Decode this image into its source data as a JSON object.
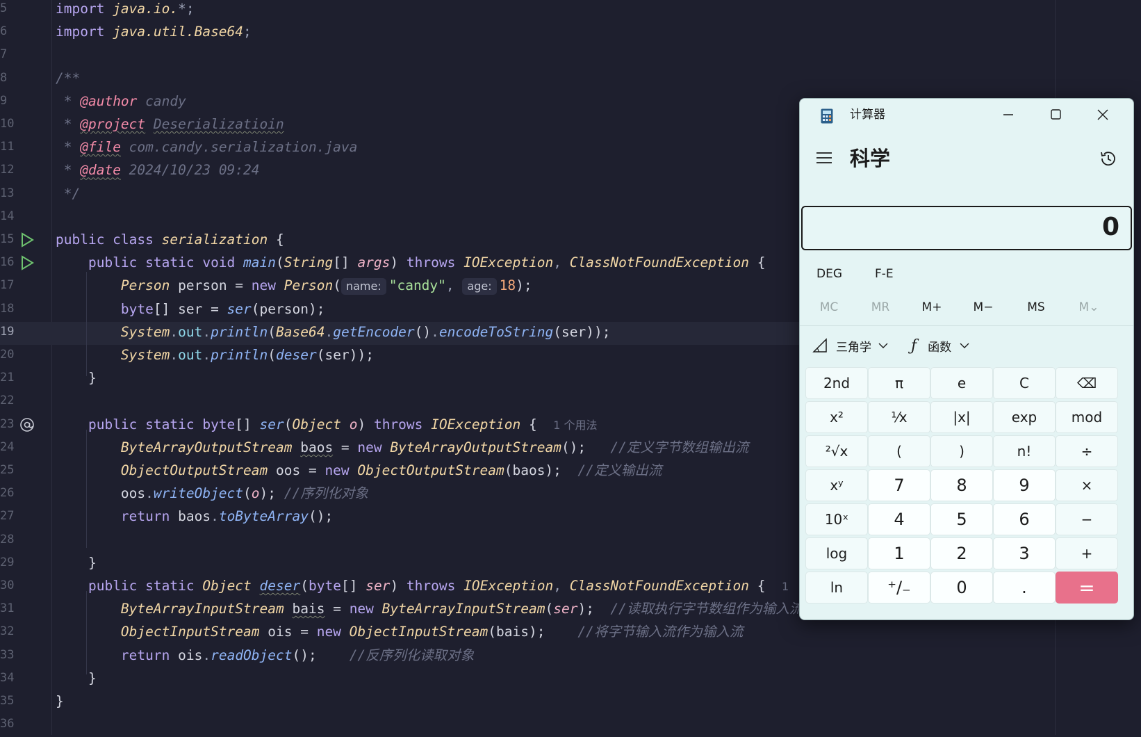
{
  "editor": {
    "lines": [
      {
        "n": "5",
        "parts": [
          [
            "kw",
            "import "
          ],
          [
            "cls",
            "java.io."
          ],
          [
            "p",
            "*"
          ],
          [
            "p",
            ";"
          ]
        ]
      },
      {
        "n": "6",
        "parts": [
          [
            "kw",
            "import "
          ],
          [
            "cls",
            "java.util.Base64"
          ],
          [
            "p",
            ";"
          ]
        ]
      },
      {
        "n": "7",
        "parts": []
      },
      {
        "n": "8",
        "parts": [
          [
            "cm",
            "/**"
          ]
        ]
      },
      {
        "n": "9",
        "parts": [
          [
            "cm",
            " * "
          ],
          [
            "tag",
            "@author"
          ],
          [
            "cm",
            " candy"
          ]
        ]
      },
      {
        "n": "10",
        "parts": [
          [
            "cm",
            " * "
          ],
          [
            "tag",
            "@project",
            "u"
          ],
          [
            "cm",
            " "
          ],
          [
            "cm",
            "Deserializatioin",
            "u"
          ]
        ]
      },
      {
        "n": "11",
        "parts": [
          [
            "cm",
            " * "
          ],
          [
            "tag",
            "@file",
            "u"
          ],
          [
            "cm",
            " com.candy.serialization.java"
          ]
        ]
      },
      {
        "n": "12",
        "parts": [
          [
            "cm",
            " * "
          ],
          [
            "tag",
            "@date",
            "u"
          ],
          [
            "cm",
            " 2024/10/23 09:24"
          ]
        ]
      },
      {
        "n": "13",
        "parts": [
          [
            "cm",
            " */"
          ]
        ]
      },
      {
        "n": "14",
        "parts": []
      },
      {
        "n": "15",
        "icon": "run",
        "parts": [
          [
            "kw",
            "public class "
          ],
          [
            "cls",
            "serialization"
          ],
          [
            "t",
            " {"
          ]
        ]
      },
      {
        "n": "16",
        "icon": "run",
        "parts": [
          [
            "t",
            "    "
          ],
          [
            "kw",
            "public static void "
          ],
          [
            "fn",
            "main"
          ],
          [
            "t",
            "("
          ],
          [
            "cls",
            "String"
          ],
          [
            "t",
            "[] "
          ],
          [
            "par",
            "args"
          ],
          [
            "t",
            ") "
          ],
          [
            "kw",
            "throws "
          ],
          [
            "cls",
            "IOException"
          ],
          [
            "p",
            ", "
          ],
          [
            "cls",
            "ClassNotFoundException"
          ],
          [
            "t",
            " {"
          ]
        ]
      },
      {
        "n": "17",
        "parts": [
          [
            "t",
            "        "
          ],
          [
            "cls",
            "Person"
          ],
          [
            "t",
            " person = "
          ],
          [
            "kw",
            "new "
          ],
          [
            "cls",
            "Person"
          ],
          [
            "t",
            "("
          ],
          [
            "hint",
            "name:"
          ],
          [
            "str",
            "\"candy\""
          ],
          [
            "p",
            ", "
          ],
          [
            "hint",
            "age:"
          ],
          [
            "num",
            "18"
          ],
          [
            "t",
            ");"
          ]
        ]
      },
      {
        "n": "18",
        "parts": [
          [
            "t",
            "        "
          ],
          [
            "kw",
            "byte"
          ],
          [
            "t",
            "[] ser = "
          ],
          [
            "fn",
            "ser"
          ],
          [
            "t",
            "(person);"
          ]
        ]
      },
      {
        "n": "19",
        "hl": true,
        "parts": [
          [
            "t",
            "        "
          ],
          [
            "cls",
            "System"
          ],
          [
            "p",
            "."
          ],
          [
            "fld",
            "out"
          ],
          [
            "p",
            "."
          ],
          [
            "fn",
            "println"
          ],
          [
            "t",
            "("
          ],
          [
            "cls",
            "Base64"
          ],
          [
            "p",
            "."
          ],
          [
            "fn",
            "getEncoder"
          ],
          [
            "t",
            "()"
          ],
          [
            "p",
            "."
          ],
          [
            "fn",
            "encodeToString"
          ],
          [
            "t",
            "(ser));"
          ]
        ]
      },
      {
        "n": "20",
        "parts": [
          [
            "t",
            "        "
          ],
          [
            "cls",
            "System"
          ],
          [
            "p",
            "."
          ],
          [
            "fld",
            "out"
          ],
          [
            "p",
            "."
          ],
          [
            "fn",
            "println"
          ],
          [
            "t",
            "("
          ],
          [
            "fn",
            "deser"
          ],
          [
            "t",
            "(ser));"
          ]
        ]
      },
      {
        "n": "21",
        "parts": [
          [
            "t",
            "    }"
          ]
        ]
      },
      {
        "n": "22",
        "parts": []
      },
      {
        "n": "23",
        "icon": "at",
        "parts": [
          [
            "t",
            "    "
          ],
          [
            "kw",
            "public static byte"
          ],
          [
            "t",
            "[] "
          ],
          [
            "fn",
            "ser"
          ],
          [
            "t",
            "("
          ],
          [
            "cls",
            "Object"
          ],
          [
            "t",
            " "
          ],
          [
            "par",
            "o"
          ],
          [
            "t",
            ") "
          ],
          [
            "kw",
            "throws "
          ],
          [
            "cls",
            "IOException"
          ],
          [
            "t",
            " {  "
          ],
          [
            "usage",
            "1 个用法"
          ]
        ]
      },
      {
        "n": "24",
        "parts": [
          [
            "t",
            "        "
          ],
          [
            "cls",
            "ByteArrayOutputStream"
          ],
          [
            "t",
            " "
          ],
          [
            "t",
            "baos",
            "u"
          ],
          [
            "t",
            " = "
          ],
          [
            "kw",
            "new "
          ],
          [
            "cls",
            "ByteArrayOutputStream"
          ],
          [
            "t",
            "();   "
          ],
          [
            "cm",
            "//定义字节数组输出流"
          ]
        ]
      },
      {
        "n": "25",
        "parts": [
          [
            "t",
            "        "
          ],
          [
            "cls",
            "ObjectOutputStream"
          ],
          [
            "t",
            " oos = "
          ],
          [
            "kw",
            "new "
          ],
          [
            "cls",
            "ObjectOutputStream"
          ],
          [
            "t",
            "(baos);  "
          ],
          [
            "cm",
            "//定义输出流"
          ]
        ]
      },
      {
        "n": "26",
        "parts": [
          [
            "t",
            "        oos"
          ],
          [
            "p",
            "."
          ],
          [
            "fn",
            "writeObject"
          ],
          [
            "t",
            "("
          ],
          [
            "par",
            "o"
          ],
          [
            "t",
            "); "
          ],
          [
            "cm",
            "//序列化对象"
          ]
        ]
      },
      {
        "n": "27",
        "parts": [
          [
            "t",
            "        "
          ],
          [
            "kw",
            "return "
          ],
          [
            "t",
            "baos"
          ],
          [
            "p",
            "."
          ],
          [
            "fn",
            "toByteArray"
          ],
          [
            "t",
            "();"
          ]
        ]
      },
      {
        "n": "28",
        "parts": []
      },
      {
        "n": "29",
        "parts": [
          [
            "t",
            "    }"
          ]
        ]
      },
      {
        "n": "30",
        "parts": [
          [
            "t",
            "    "
          ],
          [
            "kw",
            "public static "
          ],
          [
            "cls",
            "Object"
          ],
          [
            "t",
            " "
          ],
          [
            "fn",
            "deser",
            "u"
          ],
          [
            "t",
            "("
          ],
          [
            "kw",
            "byte"
          ],
          [
            "t",
            "[] "
          ],
          [
            "par",
            "ser"
          ],
          [
            "t",
            ") "
          ],
          [
            "kw",
            "throws "
          ],
          [
            "cls",
            "IOException"
          ],
          [
            "p",
            ", "
          ],
          [
            "cls",
            "ClassNotFoundException"
          ],
          [
            "t",
            " {  "
          ],
          [
            "usage",
            "1"
          ]
        ]
      },
      {
        "n": "31",
        "parts": [
          [
            "t",
            "        "
          ],
          [
            "cls",
            "ByteArrayInputStream"
          ],
          [
            "t",
            " "
          ],
          [
            "t",
            "bais",
            "u"
          ],
          [
            "t",
            " = "
          ],
          [
            "kw",
            "new "
          ],
          [
            "cls",
            "ByteArrayInputStream"
          ],
          [
            "t",
            "("
          ],
          [
            "par",
            "ser"
          ],
          [
            "t",
            ");  "
          ],
          [
            "cm",
            "//读取执行字节数组作为输入流"
          ]
        ]
      },
      {
        "n": "32",
        "parts": [
          [
            "t",
            "        "
          ],
          [
            "cls",
            "ObjectInputStream"
          ],
          [
            "t",
            " ois = "
          ],
          [
            "kw",
            "new "
          ],
          [
            "cls",
            "ObjectInputStream"
          ],
          [
            "t",
            "(bais);    "
          ],
          [
            "cm",
            "//将字节输入流作为输入流"
          ]
        ]
      },
      {
        "n": "33",
        "parts": [
          [
            "t",
            "        "
          ],
          [
            "kw",
            "return "
          ],
          [
            "t",
            "ois"
          ],
          [
            "p",
            "."
          ],
          [
            "fn",
            "readObject"
          ],
          [
            "t",
            "();    "
          ],
          [
            "cm",
            "//反序列化读取对象"
          ]
        ]
      },
      {
        "n": "34",
        "parts": [
          [
            "t",
            "    }"
          ]
        ]
      },
      {
        "n": "35",
        "parts": [
          [
            "t",
            "}"
          ]
        ]
      },
      {
        "n": "36",
        "parts": []
      }
    ]
  },
  "calculator": {
    "title": "计算器",
    "mode": "科学",
    "display": "0",
    "angle_mode": "DEG",
    "fe": "F-E",
    "memory": [
      {
        "label": "MC",
        "enabled": false
      },
      {
        "label": "MR",
        "enabled": false
      },
      {
        "label": "M+",
        "enabled": true
      },
      {
        "label": "M−",
        "enabled": true
      },
      {
        "label": "MS",
        "enabled": true
      },
      {
        "label": "M⌄",
        "enabled": false
      }
    ],
    "trig_label": "三角学",
    "func_label": "函数",
    "keys": [
      [
        {
          "l": "2nd",
          "k": "fn"
        },
        {
          "l": "π",
          "k": "fn"
        },
        {
          "l": "e",
          "k": "fn"
        },
        {
          "l": "C",
          "k": "fn"
        },
        {
          "l": "⌫",
          "k": "fn"
        }
      ],
      [
        {
          "l": "x²",
          "k": "fn"
        },
        {
          "l": "¹⁄x",
          "k": "fn"
        },
        {
          "l": "|x|",
          "k": "fn"
        },
        {
          "l": "exp",
          "k": "fn"
        },
        {
          "l": "mod",
          "k": "fn"
        }
      ],
      [
        {
          "l": "²√x",
          "k": "fn"
        },
        {
          "l": "(",
          "k": "fn"
        },
        {
          "l": ")",
          "k": "fn"
        },
        {
          "l": "n!",
          "k": "fn"
        },
        {
          "l": "÷",
          "k": "fn"
        }
      ],
      [
        {
          "l": "xʸ",
          "k": "fn"
        },
        {
          "l": "7",
          "k": "num"
        },
        {
          "l": "8",
          "k": "num"
        },
        {
          "l": "9",
          "k": "num"
        },
        {
          "l": "×",
          "k": "fn"
        }
      ],
      [
        {
          "l": "10ˣ",
          "k": "fn"
        },
        {
          "l": "4",
          "k": "num"
        },
        {
          "l": "5",
          "k": "num"
        },
        {
          "l": "6",
          "k": "num"
        },
        {
          "l": "−",
          "k": "fn"
        }
      ],
      [
        {
          "l": "log",
          "k": "fn"
        },
        {
          "l": "1",
          "k": "num"
        },
        {
          "l": "2",
          "k": "num"
        },
        {
          "l": "3",
          "k": "num"
        },
        {
          "l": "+",
          "k": "fn"
        }
      ],
      [
        {
          "l": "ln",
          "k": "fn"
        },
        {
          "l": "⁺∕₋",
          "k": "num"
        },
        {
          "l": "0",
          "k": "num"
        },
        {
          "l": ".",
          "k": "num"
        },
        {
          "l": "=",
          "k": "eq"
        }
      ]
    ]
  }
}
